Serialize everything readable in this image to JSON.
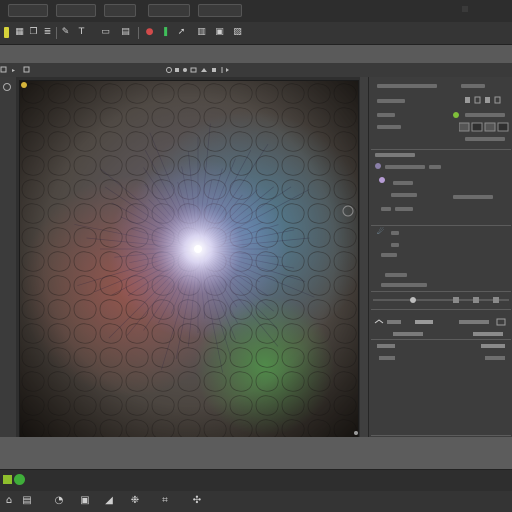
{
  "menubar": {
    "tabs": [
      "",
      "",
      "",
      "",
      ""
    ]
  },
  "toolbar": {
    "icons": [
      "color-swatch-icon",
      "grid-icon",
      "duplicate-icon",
      "layers-icon",
      "pen-icon",
      "text-icon",
      "frame-icon",
      "record-icon",
      "bookmark-icon",
      "table-icon",
      "layout-icon",
      "export-icon"
    ]
  },
  "optionsbar": {
    "left_label": "",
    "center_label": ""
  },
  "canvas": {
    "description_colors": {
      "center_glow": "#ffffff",
      "petal": "#8f78c9",
      "blue": "#4b8fae",
      "red": "#a85548",
      "green": "#4f9a4a",
      "outer": "#3a2f25"
    }
  },
  "right_panel": {
    "header": ""
  },
  "statusbar": {
    "indicator_colors": [
      "#8fbf2d",
      "#3fae3a"
    ]
  },
  "bottombar": {
    "icons": [
      "home-icon",
      "document-icon",
      "cursor-icon",
      "spiral-icon",
      "nodes-icon",
      "run-icon"
    ]
  },
  "theme": {
    "accent": "#9ad33a"
  }
}
